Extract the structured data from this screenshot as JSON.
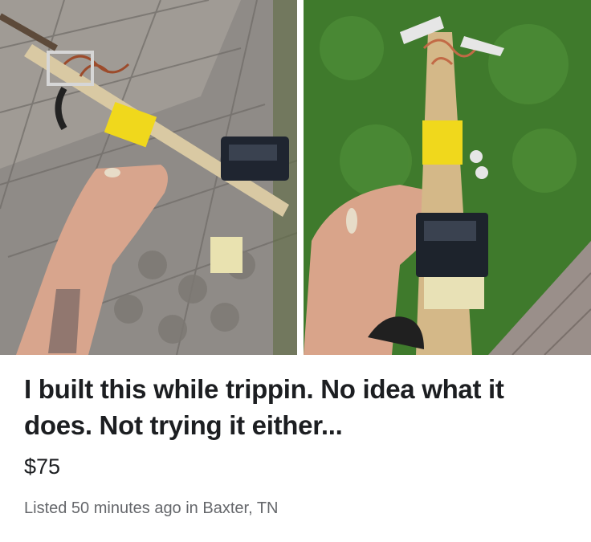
{
  "listing": {
    "title": "I built this while trippin. No idea what it does. Not trying it either...",
    "price": "$75",
    "meta": "Listed 50 minutes ago in Baxter, TN"
  },
  "photos": [
    {
      "name": "photo-left",
      "subject": "hand holding homemade gadget over paving stones"
    },
    {
      "name": "photo-right",
      "subject": "hand holding homemade gadget over grass"
    }
  ],
  "colors": {
    "title": "#1c1e21",
    "meta": "#65676b",
    "pavement": "#8e8a86",
    "grass": "#3f7a2c",
    "tape": "#f0d81c",
    "skin": "#d9a48a"
  }
}
